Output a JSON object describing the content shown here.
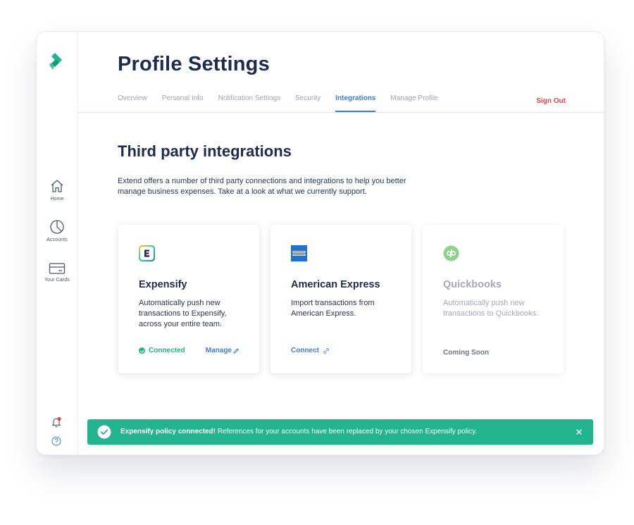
{
  "sidebar": {
    "logo_icon": "extend-logo-icon",
    "items": [
      {
        "label": "Home",
        "icon": "home-icon"
      },
      {
        "label": "Accounts",
        "icon": "pie-chart-icon"
      },
      {
        "label": "Your Cards",
        "icon": "credit-card-icon"
      }
    ],
    "footer_icons": [
      "bell-icon",
      "help-icon"
    ]
  },
  "header": {
    "title": "Profile Settings",
    "tabs": [
      {
        "label": "Overview",
        "active": false
      },
      {
        "label": "Personal Info",
        "active": false
      },
      {
        "label": "Notification Settings",
        "active": false
      },
      {
        "label": "Security",
        "active": false
      },
      {
        "label": "Integrations",
        "active": true
      },
      {
        "label": "Manage Profile",
        "active": false
      }
    ],
    "sign_out": "Sign Out"
  },
  "section": {
    "title": "Third party integrations",
    "description": "Extend offers a number of third party connections and integrations to help you better manage business expenses. Take at a look at what we currently support."
  },
  "integrations": [
    {
      "name": "Expensify",
      "icon": "expensify-logo-icon",
      "description": "Automatically push new transactions to Expensify, across your entire team.",
      "status": "Connected",
      "action": "Manage"
    },
    {
      "name": "American Express",
      "icon": "amex-logo-icon",
      "description": "Import transactions from American Express.",
      "action": "Connect"
    },
    {
      "name": "Quickbooks",
      "icon": "quickbooks-logo-icon",
      "description": "Automatically push new transactions to Quickbooks.",
      "status": "Coming Soon"
    }
  ],
  "toast": {
    "title": "Expensify policy connected!",
    "message": "References for your accounts have been replaced by your chosen Expensify policy."
  },
  "colors": {
    "accent": "#3c7cd8",
    "success": "#22b48c",
    "danger": "#e0454b",
    "brand": "#1fb791",
    "heading": "#1d2b4f"
  }
}
